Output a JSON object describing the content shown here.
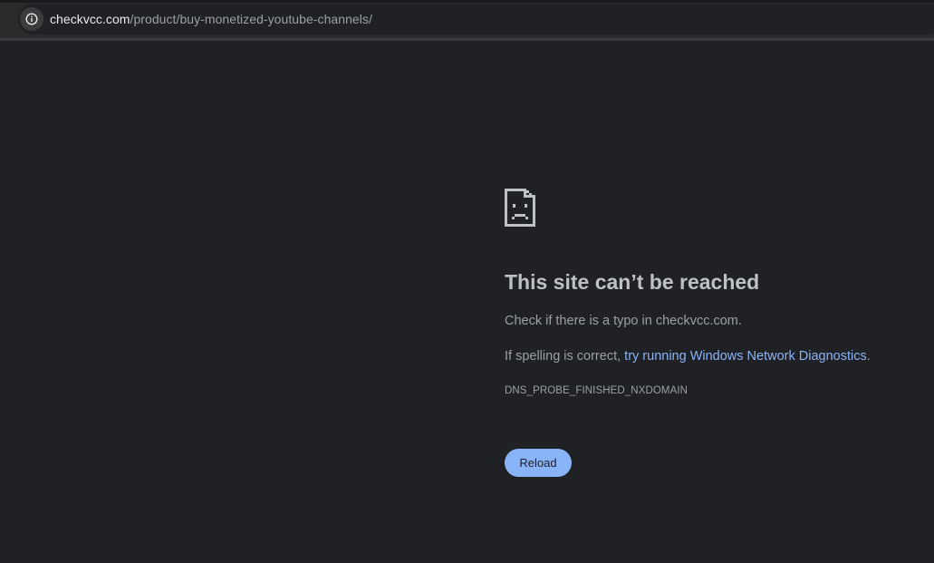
{
  "address_bar": {
    "host": "checkvcc.com",
    "path": "/product/buy-monetized-youtube-channels/",
    "info_icon": "info-icon"
  },
  "error_page": {
    "icon": "sad-page-icon",
    "title": "This site can’t be reached",
    "line1": "Check if there is a typo in checkvcc.com.",
    "line2_prefix": "If spelling is correct, ",
    "line2_link": "try running Windows Network Diagnostics",
    "line2_suffix": ".",
    "error_code": "DNS_PROBE_FINISHED_NXDOMAIN",
    "reload_label": "Reload"
  },
  "colors": {
    "background": "#202124",
    "title": "#bdc1c6",
    "body_text": "#9aa0a6",
    "link": "#8ab4f8",
    "button": "#8ab4f8"
  }
}
